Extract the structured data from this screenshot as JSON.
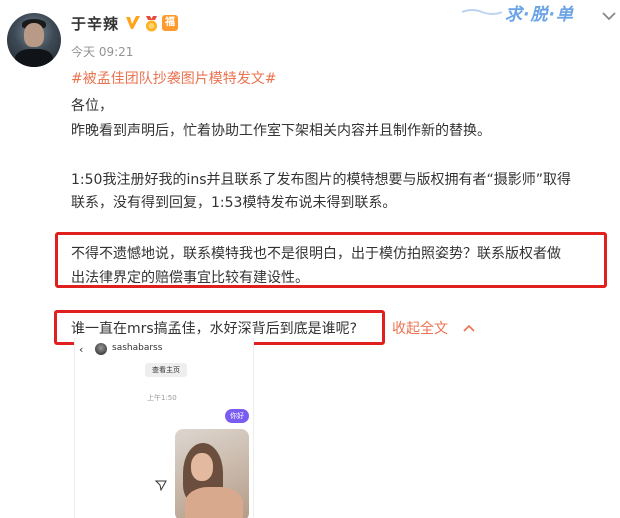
{
  "header": {
    "username": "于辛辣",
    "level_badge": "福",
    "timestamp": "今天 09:21",
    "watermark": "求·脱·单"
  },
  "post": {
    "hashtag": "#被孟佳团队抄袭图片模特发文#",
    "lines": [
      "各位，",
      "昨晚看到声明后，忙着协助工作室下架相关内容并且制作新的替换。",
      "1:50我注册好我的ins并且联系了发布图片的模特想要与版权拥有者“摄影师”取得",
      "联系，没有得到回复，1:53模特发布说未得到联系。",
      "不得不遗憾地说，联系模特我也不是很明白，出于模仿拍照姿势？联系版权者做",
      "出法律界定的赔偿事宜比较有建设性。"
    ],
    "last_line": "谁一直在mrs搞孟佳，水好深背后到底是谁呢?",
    "collapse_label": "收起全文"
  },
  "embedded_screenshot": {
    "username": "sashabarss",
    "view_profile": "查看主页",
    "time": "上午1:50",
    "message": "你好"
  },
  "colors": {
    "link": "#eb7350",
    "highlight_box": "#e0201f",
    "watermark": "#6aa3e6",
    "verified": "#ffa41b"
  }
}
